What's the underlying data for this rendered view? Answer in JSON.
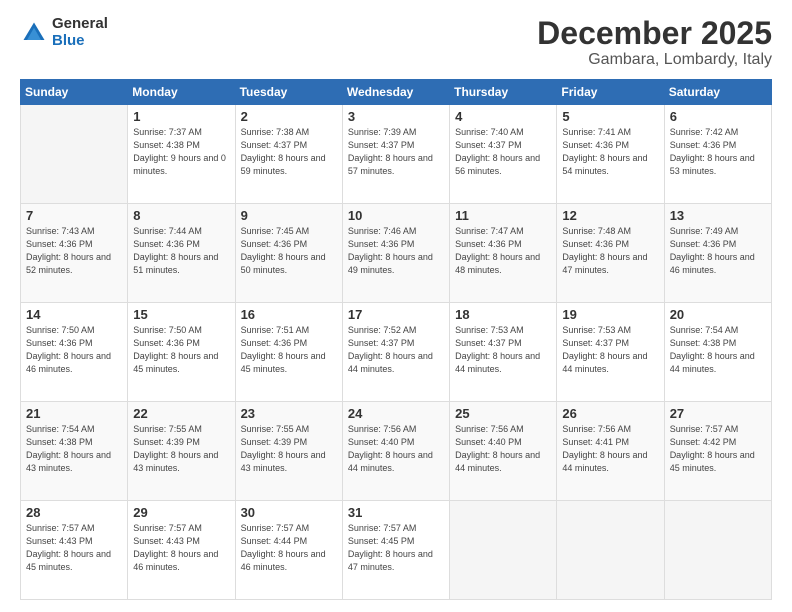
{
  "header": {
    "logo_general": "General",
    "logo_blue": "Blue",
    "title": "December 2025",
    "location": "Gambara, Lombardy, Italy"
  },
  "days_of_week": [
    "Sunday",
    "Monday",
    "Tuesday",
    "Wednesday",
    "Thursday",
    "Friday",
    "Saturday"
  ],
  "weeks": [
    [
      {
        "day": "",
        "empty": true
      },
      {
        "day": "1",
        "sunrise": "7:37 AM",
        "sunset": "4:38 PM",
        "daylight": "9 hours and 0 minutes."
      },
      {
        "day": "2",
        "sunrise": "7:38 AM",
        "sunset": "4:37 PM",
        "daylight": "8 hours and 59 minutes."
      },
      {
        "day": "3",
        "sunrise": "7:39 AM",
        "sunset": "4:37 PM",
        "daylight": "8 hours and 57 minutes."
      },
      {
        "day": "4",
        "sunrise": "7:40 AM",
        "sunset": "4:37 PM",
        "daylight": "8 hours and 56 minutes."
      },
      {
        "day": "5",
        "sunrise": "7:41 AM",
        "sunset": "4:36 PM",
        "daylight": "8 hours and 54 minutes."
      },
      {
        "day": "6",
        "sunrise": "7:42 AM",
        "sunset": "4:36 PM",
        "daylight": "8 hours and 53 minutes."
      }
    ],
    [
      {
        "day": "7",
        "sunrise": "7:43 AM",
        "sunset": "4:36 PM",
        "daylight": "8 hours and 52 minutes."
      },
      {
        "day": "8",
        "sunrise": "7:44 AM",
        "sunset": "4:36 PM",
        "daylight": "8 hours and 51 minutes."
      },
      {
        "day": "9",
        "sunrise": "7:45 AM",
        "sunset": "4:36 PM",
        "daylight": "8 hours and 50 minutes."
      },
      {
        "day": "10",
        "sunrise": "7:46 AM",
        "sunset": "4:36 PM",
        "daylight": "8 hours and 49 minutes."
      },
      {
        "day": "11",
        "sunrise": "7:47 AM",
        "sunset": "4:36 PM",
        "daylight": "8 hours and 48 minutes."
      },
      {
        "day": "12",
        "sunrise": "7:48 AM",
        "sunset": "4:36 PM",
        "daylight": "8 hours and 47 minutes."
      },
      {
        "day": "13",
        "sunrise": "7:49 AM",
        "sunset": "4:36 PM",
        "daylight": "8 hours and 46 minutes."
      }
    ],
    [
      {
        "day": "14",
        "sunrise": "7:50 AM",
        "sunset": "4:36 PM",
        "daylight": "8 hours and 46 minutes."
      },
      {
        "day": "15",
        "sunrise": "7:50 AM",
        "sunset": "4:36 PM",
        "daylight": "8 hours and 45 minutes."
      },
      {
        "day": "16",
        "sunrise": "7:51 AM",
        "sunset": "4:36 PM",
        "daylight": "8 hours and 45 minutes."
      },
      {
        "day": "17",
        "sunrise": "7:52 AM",
        "sunset": "4:37 PM",
        "daylight": "8 hours and 44 minutes."
      },
      {
        "day": "18",
        "sunrise": "7:53 AM",
        "sunset": "4:37 PM",
        "daylight": "8 hours and 44 minutes."
      },
      {
        "day": "19",
        "sunrise": "7:53 AM",
        "sunset": "4:37 PM",
        "daylight": "8 hours and 44 minutes."
      },
      {
        "day": "20",
        "sunrise": "7:54 AM",
        "sunset": "4:38 PM",
        "daylight": "8 hours and 44 minutes."
      }
    ],
    [
      {
        "day": "21",
        "sunrise": "7:54 AM",
        "sunset": "4:38 PM",
        "daylight": "8 hours and 43 minutes."
      },
      {
        "day": "22",
        "sunrise": "7:55 AM",
        "sunset": "4:39 PM",
        "daylight": "8 hours and 43 minutes."
      },
      {
        "day": "23",
        "sunrise": "7:55 AM",
        "sunset": "4:39 PM",
        "daylight": "8 hours and 43 minutes."
      },
      {
        "day": "24",
        "sunrise": "7:56 AM",
        "sunset": "4:40 PM",
        "daylight": "8 hours and 44 minutes."
      },
      {
        "day": "25",
        "sunrise": "7:56 AM",
        "sunset": "4:40 PM",
        "daylight": "8 hours and 44 minutes."
      },
      {
        "day": "26",
        "sunrise": "7:56 AM",
        "sunset": "4:41 PM",
        "daylight": "8 hours and 44 minutes."
      },
      {
        "day": "27",
        "sunrise": "7:57 AM",
        "sunset": "4:42 PM",
        "daylight": "8 hours and 45 minutes."
      }
    ],
    [
      {
        "day": "28",
        "sunrise": "7:57 AM",
        "sunset": "4:43 PM",
        "daylight": "8 hours and 45 minutes."
      },
      {
        "day": "29",
        "sunrise": "7:57 AM",
        "sunset": "4:43 PM",
        "daylight": "8 hours and 46 minutes."
      },
      {
        "day": "30",
        "sunrise": "7:57 AM",
        "sunset": "4:44 PM",
        "daylight": "8 hours and 46 minutes."
      },
      {
        "day": "31",
        "sunrise": "7:57 AM",
        "sunset": "4:45 PM",
        "daylight": "8 hours and 47 minutes."
      },
      {
        "day": "",
        "empty": true
      },
      {
        "day": "",
        "empty": true
      },
      {
        "day": "",
        "empty": true
      }
    ]
  ]
}
